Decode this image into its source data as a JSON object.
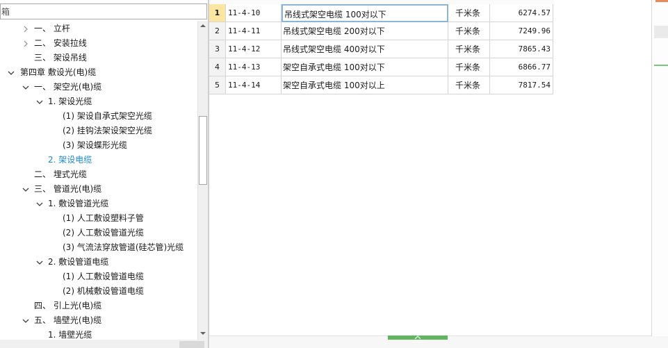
{
  "search": {
    "text": "箱"
  },
  "tree": [
    {
      "label": "一、 立杆",
      "expanded": false,
      "hasChildren": true
    },
    {
      "label": "二、 安装拉线",
      "expanded": false,
      "hasChildren": true
    },
    {
      "label": "三、 架设吊线",
      "hasChildren": false
    },
    {
      "label": "第四章 敷设光(电)缆",
      "expanded": true,
      "hasChildren": true
    },
    {
      "label": "一、 架空光(电)缆",
      "expanded": true,
      "hasChildren": true
    },
    {
      "label": "1. 架设光缆",
      "expanded": true,
      "hasChildren": true
    },
    {
      "label": "(1) 架设自承式架空光缆",
      "hasChildren": false
    },
    {
      "label": "(2) 挂钩法架设架空光缆",
      "hasChildren": false
    },
    {
      "label": "(3) 架设蝶形光缆",
      "hasChildren": false
    },
    {
      "label": "2. 架设电缆",
      "hasChildren": false,
      "selected": true
    },
    {
      "label": "二、 埋式光缆",
      "hasChildren": false
    },
    {
      "label": "三、 管道光(电)缆",
      "expanded": true,
      "hasChildren": true
    },
    {
      "label": "1. 敷设管道光缆",
      "expanded": true,
      "hasChildren": true
    },
    {
      "label": "(1) 人工敷设塑料子管",
      "hasChildren": false
    },
    {
      "label": "(2) 人工敷设管道光缆",
      "hasChildren": false
    },
    {
      "label": "(3) 气流法穿放管道(硅芯管)光缆",
      "hasChildren": false
    },
    {
      "label": "2. 敷设管道电缆",
      "expanded": true,
      "hasChildren": true
    },
    {
      "label": "(1) 人工敷设管道电缆",
      "hasChildren": false
    },
    {
      "label": "(2) 机械敷设管道电缆",
      "hasChildren": false
    },
    {
      "label": "四、 引上光(电)缆",
      "hasChildren": false
    },
    {
      "label": "五、 墙壁光(电)缆",
      "expanded": true,
      "hasChildren": true
    },
    {
      "label": "1. 墙壁光缆",
      "hasChildren": false
    }
  ],
  "grid": {
    "rows": [
      {
        "index": "1",
        "code": "11-4-10",
        "name": "吊线式架空电缆 100对以下",
        "unit": "千米条",
        "price": "6274.57",
        "active": true
      },
      {
        "index": "2",
        "code": "11-4-11",
        "name": "吊线式架空电缆 200对以下",
        "unit": "千米条",
        "price": "7249.96"
      },
      {
        "index": "3",
        "code": "11-4-12",
        "name": "吊线式架空电缆 400对以下",
        "unit": "千米条",
        "price": "7865.43"
      },
      {
        "index": "4",
        "code": "11-4-13",
        "name": "架空自承式电缆 100对以下",
        "unit": "千米条",
        "price": "6866.77"
      },
      {
        "index": "5",
        "code": "11-4-14",
        "name": "架空自承式电缆 100对以上",
        "unit": "千米条",
        "price": "7817.54"
      }
    ]
  },
  "colors": {
    "selected_text": "#1e8ad6",
    "active_row_index_bg": "#fbe7a1",
    "green_handle": "#5fb65f"
  },
  "icons": {
    "collapsed": "chevron-right-icon",
    "expanded": "chevron-down-icon",
    "scroll_up": "arrow-up-icon",
    "scroll_down": "arrow-down-icon",
    "splitter_handle": "chevron-up-icon"
  }
}
